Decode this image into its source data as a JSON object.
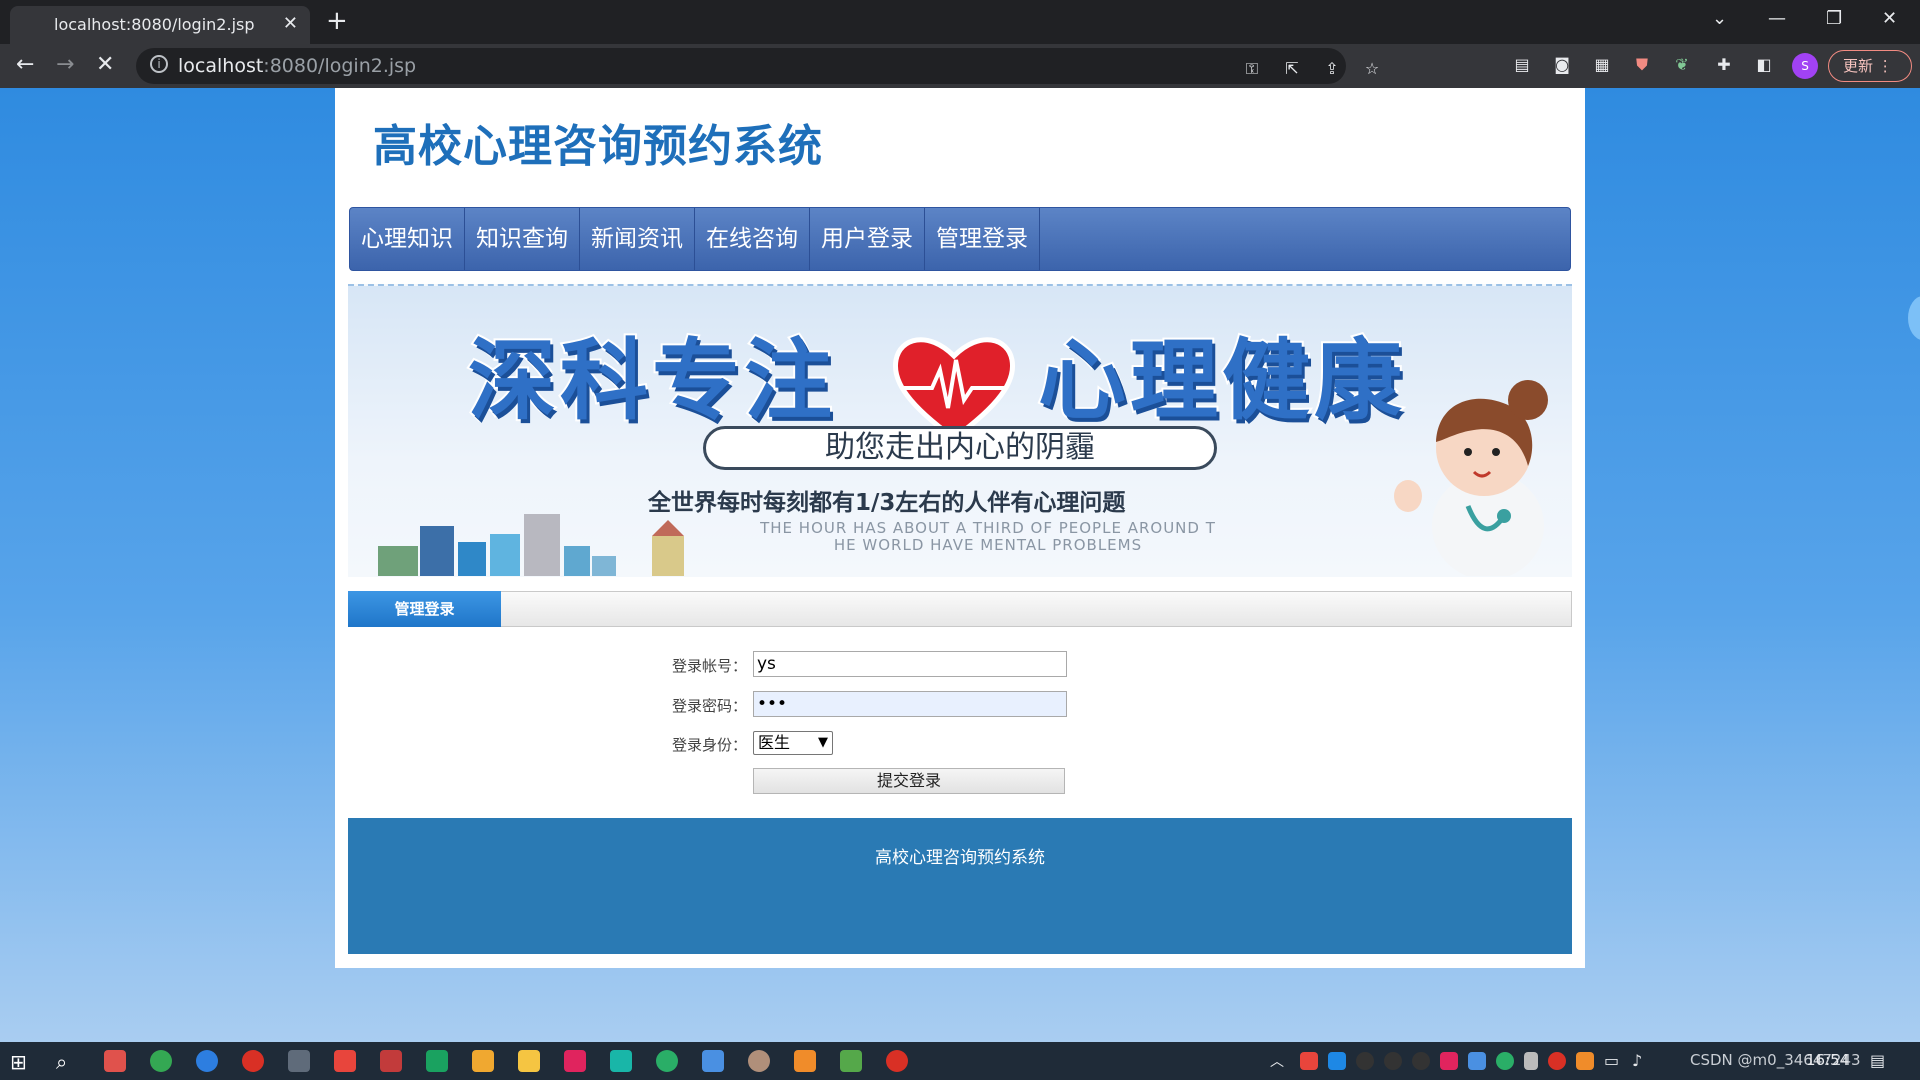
{
  "browser": {
    "tab_title": "localhost:8080/login2.jsp",
    "tab_close": "✕",
    "new_tab": "+",
    "url_host": "localhost",
    "url_rest": ":8080/login2.jsp",
    "update_label": "更新",
    "avatar_letter": "S"
  },
  "site": {
    "title": "高校心理咨询预约系统",
    "menu": [
      "心理知识",
      "知识查询",
      "新闻资讯",
      "在线咨询",
      "用户登录",
      "管理登录"
    ]
  },
  "banner": {
    "title_left": "深科专注",
    "title_right": "心理健康",
    "subtitle": "助您走出内心的阴霾",
    "line1": "全世界每时每刻都有1/3左右的人伴有心理问题",
    "line2a": "THE HOUR HAS ABOUT A THIRD OF PEOPLE AROUND T",
    "line2b": "HE WORLD HAVE MENTAL PROBLEMS"
  },
  "section": {
    "tab_label": "管理登录"
  },
  "form": {
    "account_label": "登录帐号：",
    "account_value": "ys",
    "password_label": "登录密码：",
    "password_value": "•••",
    "role_label": "登录身份：",
    "role_selected": "医生",
    "submit_label": "提交登录"
  },
  "footer": {
    "text": "高校心理咨询预约系统"
  },
  "taskbar": {
    "tray_text": "CSDN @m0_34647243",
    "clock": "16:54"
  }
}
